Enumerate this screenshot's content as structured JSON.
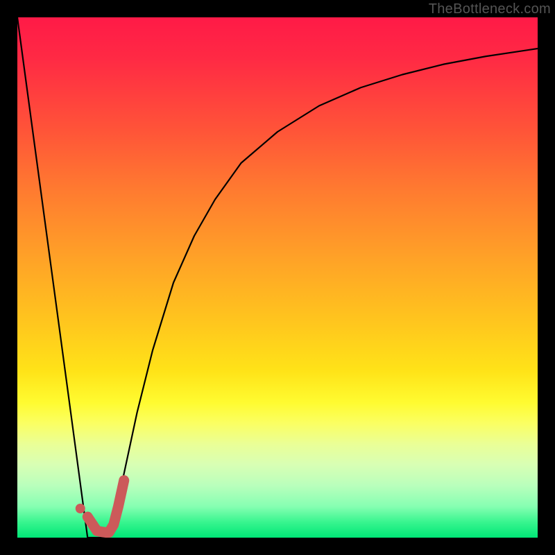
{
  "watermark": "TheBottleneck.com",
  "colors": {
    "curve": "#000000",
    "marker_fill": "#cc5a5a",
    "marker_stroke": "#cc5a5a",
    "gradient_top": "#ff1a47",
    "gradient_bottom": "#00e676",
    "page_bg": "#000000"
  },
  "chart_data": {
    "type": "line",
    "title": "",
    "xlabel": "",
    "ylabel": "",
    "xlim": [
      0,
      100
    ],
    "ylim": [
      0,
      100
    ],
    "grid": false,
    "note": "Background gradient top→bottom encodes bottleneck severity (red ≈ 100%, green ≈ 0%). Curve is approximate bottleneck % vs component score; red hook marks the matched region. No numeric axis labels are visible; values below are estimated from gridless proportions.",
    "series": [
      {
        "name": "bottleneck-curve",
        "x": [
          0,
          5,
          10,
          13.5,
          15,
          16,
          17,
          18.5,
          20,
          23,
          26,
          30,
          34,
          38,
          43,
          50,
          58,
          66,
          74,
          82,
          90,
          100
        ],
        "y": [
          100,
          63,
          26,
          0,
          0,
          0,
          0,
          3,
          10,
          24,
          36,
          49,
          58,
          65,
          72,
          78,
          83,
          86.5,
          89,
          91,
          92.5,
          94
        ]
      }
    ],
    "annotations": [
      {
        "name": "optimal-marker-hook",
        "x": [
          13.5,
          15.3,
          16.3,
          17.1,
          17.6,
          18.5,
          19.4,
          20.5
        ],
        "y": [
          4,
          1.3,
          1.1,
          1,
          1,
          2.5,
          6,
          11
        ]
      },
      {
        "name": "optimal-marker-dot",
        "x": 12.1,
        "y": 5.6
      }
    ]
  }
}
